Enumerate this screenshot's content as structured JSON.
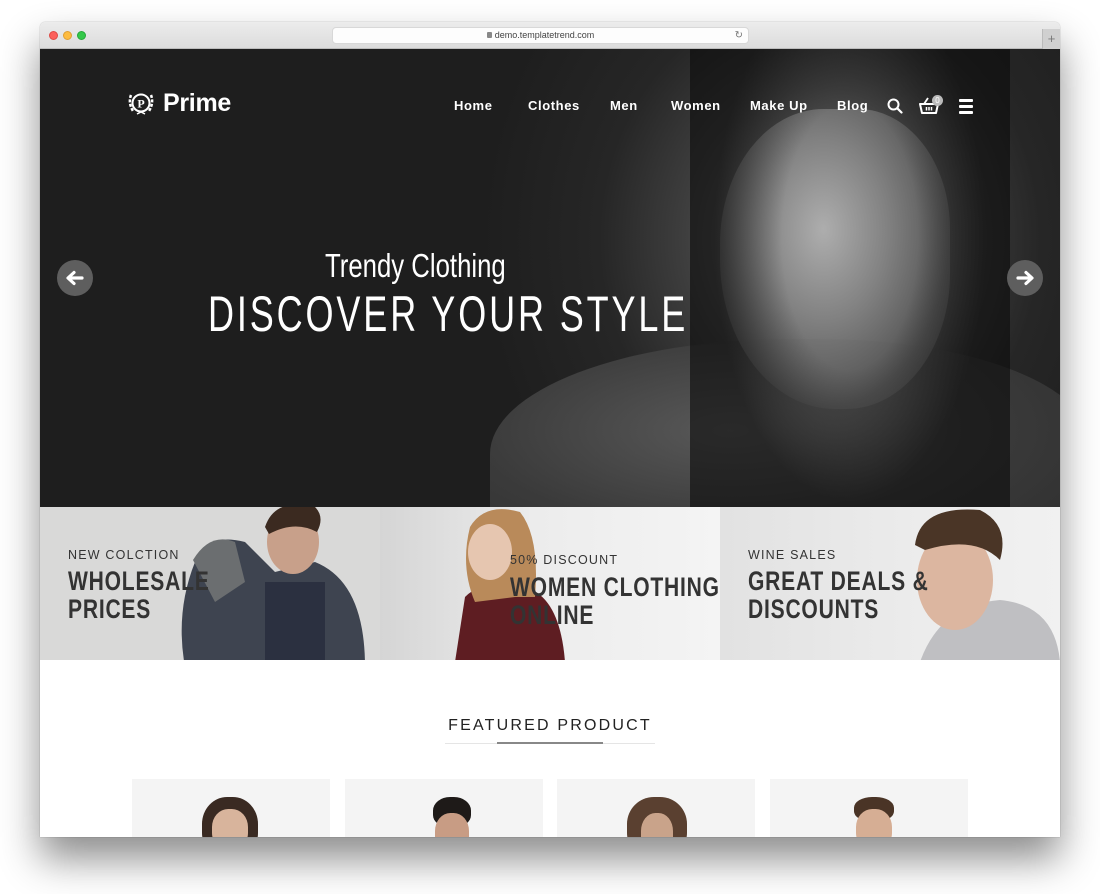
{
  "browser": {
    "url": "demo.templatetrend.com",
    "new_tab_label": "+"
  },
  "site": {
    "brand": "Prime",
    "nav": {
      "items": [
        {
          "label": "Home"
        },
        {
          "label": "Clothes"
        },
        {
          "label": "Men"
        },
        {
          "label": "Women"
        },
        {
          "label": "Make Up"
        },
        {
          "label": "Blog"
        }
      ],
      "cart_count": "0"
    },
    "hero": {
      "subtitle": "Trendy Clothing",
      "title": "DISCOVER YOUR STYLE"
    },
    "banners": [
      {
        "small": "NEW COLCTION",
        "line1": "WHOLESALE",
        "line2": "PRICES"
      },
      {
        "small": "50% DISCOUNT",
        "line1": "WOMEN CLOTHING",
        "line2": "ONLINE"
      },
      {
        "small": "WINE SALES",
        "line1": "GREAT DEALS &",
        "line2": "DISCOUNTS"
      }
    ],
    "featured": {
      "title": "FEATURED PRODUCT"
    }
  },
  "colors": {
    "hero_bg": "#1e1e1e",
    "nav_text": "#ffffff",
    "banner_text": "#333333",
    "arrow_bg": "#5e5e5e"
  }
}
